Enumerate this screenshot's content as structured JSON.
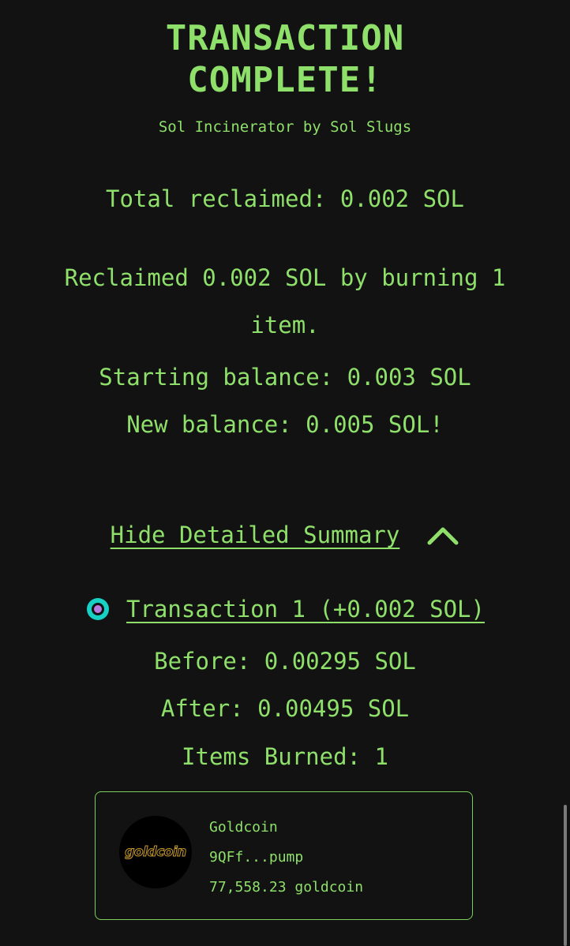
{
  "header": {
    "title_line1": "TRANSACTION",
    "title_line2": "COMPLETE!",
    "subtitle": "Sol Incinerator by Sol Slugs"
  },
  "summary": {
    "total_reclaimed": "Total reclaimed: 0.002 SOL",
    "reclaimed_message": "Reclaimed 0.002 SOL by burning 1 item.",
    "starting_balance": "Starting balance: 0.003 SOL",
    "new_balance": "New balance: 0.005 SOL!"
  },
  "details_toggle": {
    "label": "Hide Detailed Summary",
    "icon": "chevron-up-icon"
  },
  "transaction": {
    "link_label": "Transaction 1 (+0.002 SOL)",
    "icon": "solscan-icon",
    "before": "Before: 0.00295 SOL",
    "after": "After: 0.00495 SOL",
    "items_burned": "Items Burned: 1"
  },
  "token_card": {
    "name": "Goldcoin",
    "address": "9QFf...pump",
    "amount": "77,558.23 goldcoin",
    "logo_text": "goldcoin"
  },
  "colors": {
    "background": "#121212",
    "accent_green": "#8fe06b",
    "logo_gold": "#c99a2e"
  }
}
